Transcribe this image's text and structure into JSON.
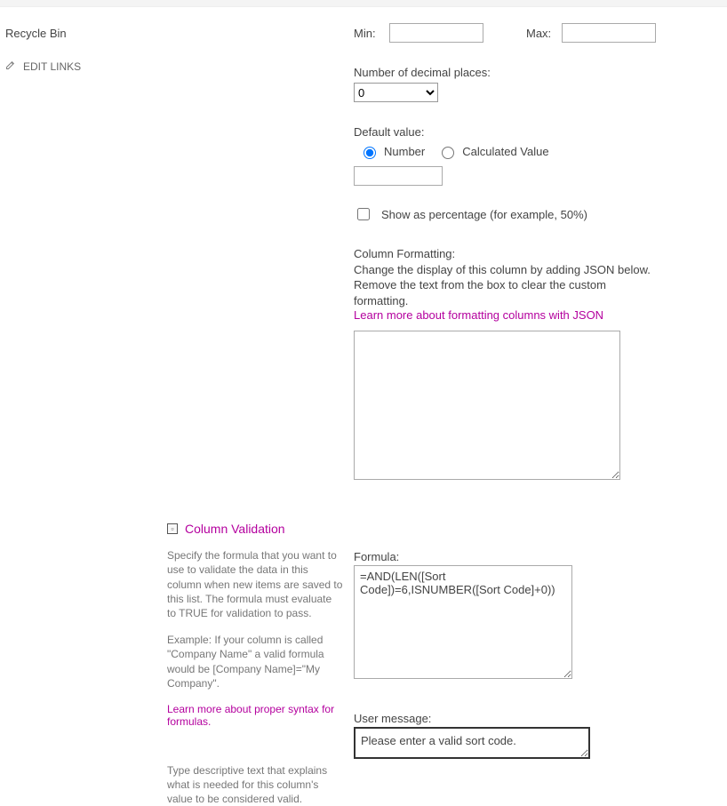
{
  "sidebar": {
    "recycle": "Recycle Bin",
    "edit_links": "EDIT LINKS"
  },
  "form": {
    "min_label": "Min:",
    "max_label": "Max:",
    "min_value": "",
    "max_value": "",
    "decimal_label": "Number of decimal places:",
    "decimal_value": "0",
    "default_label": "Default value:",
    "default_number": "Number",
    "default_calc": "Calculated Value",
    "default_value": "",
    "percentage_label": "Show as percentage (for example, 50%)",
    "cf_title": "Column Formatting:",
    "cf_help1": "Change the display of this column by adding JSON below. Remove the text from the box to clear the custom formatting.",
    "cf_link": "Learn more about formatting columns with JSON",
    "cf_value": ""
  },
  "validation": {
    "title": "Column Validation",
    "desc1": "Specify the formula that you want to use to validate the data in this column when new items are saved to this list. The formula must evaluate to TRUE for validation to pass.",
    "desc2": "Example: If your column is called \"Company Name\" a valid formula would be [Company Name]=\"My Company\".",
    "syntax_link": "Learn more about proper syntax for formulas.",
    "formula_label": "Formula:",
    "formula_value": "=AND(LEN([Sort Code])=6,ISNUMBER([Sort Code]+0))",
    "usermsg_desc": "Type descriptive text that explains what is needed for this column's value to be considered valid.",
    "usermsg_label": "User message:",
    "usermsg_value": "Please enter a valid sort code."
  }
}
